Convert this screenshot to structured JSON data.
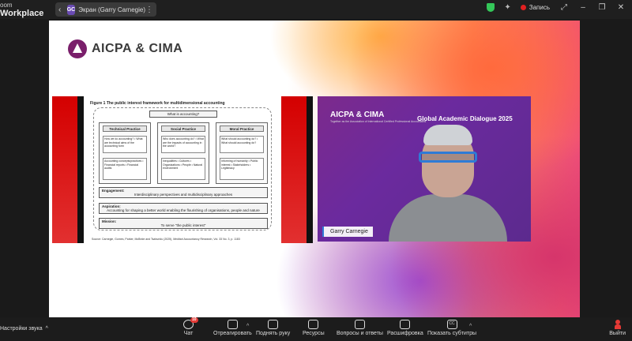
{
  "titlebar": {
    "brand_line1": "oom",
    "brand_line2": "Workplace",
    "share_label": "Экран (Garry Carnegie)",
    "avatar_initials": "GC",
    "recording_label": "Запись"
  },
  "slide": {
    "logo_text": "AICPA & CIMA",
    "document": {
      "figure_title": "Figure 1 The public interest framework for multidimensional accounting",
      "top_box": "What is accounting?",
      "columns": [
        {
          "title": "Technical Practice",
          "q": "How we do accounting? • What are technical aims of the accounting form",
          "c": "Accounting concepts/practices • Financial reports • Financial audits"
        },
        {
          "title": "Social Practice",
          "q": "Who does accounting do? • What are the impacts of accounting in the world?",
          "c": "Inequalities • Cultures • Organizations • People • Natural environment"
        },
        {
          "title": "Moral Practice",
          "q": "What should accounting do? • What should accounting do?",
          "c": "Informing of humanity • Public interest • Stakeholders • Legitimacy"
        }
      ],
      "engagement_label": "Engagement:",
      "engagement_text": "Interdisciplinary perspectives and multidisciplinary approaches",
      "aspiration_label": "Aspiration:",
      "aspiration_text": "Accounting for shaping a better world enabling the flourishing of organisations, people and nature",
      "mission_label": "Mission:",
      "mission_text": "To serve \"the public interest\"",
      "source": "Source: Carnegie, Gomes, Parker, McBride and Tsahuridu (2025), Meditari Accountancy Research, Vol. 33 No. 3, p. 1183"
    },
    "video": {
      "logo": "AICPA & CIMA",
      "logo_sub": "Together as the Association of International Certified Professional Accountants",
      "title": "Global Academic Dialogue 2025",
      "speaker_name": "Garry Carnegie"
    }
  },
  "toolbar": {
    "audio_settings": "Настройки звука",
    "chat": "Чат",
    "chat_badge": "10",
    "react": "Отреагировать",
    "raise_hand": "Поднять руку",
    "resources": "Ресурсы",
    "qa": "Вопросы и ответы",
    "transcript": "Расшифровка",
    "captions": "Показать субтитры",
    "captions_icon_text": "CC",
    "exit": "Выйти"
  },
  "colors": {
    "accent_red": "#e53935",
    "shield_green": "#34c759",
    "highlight_blue": "#2f7bd6"
  }
}
